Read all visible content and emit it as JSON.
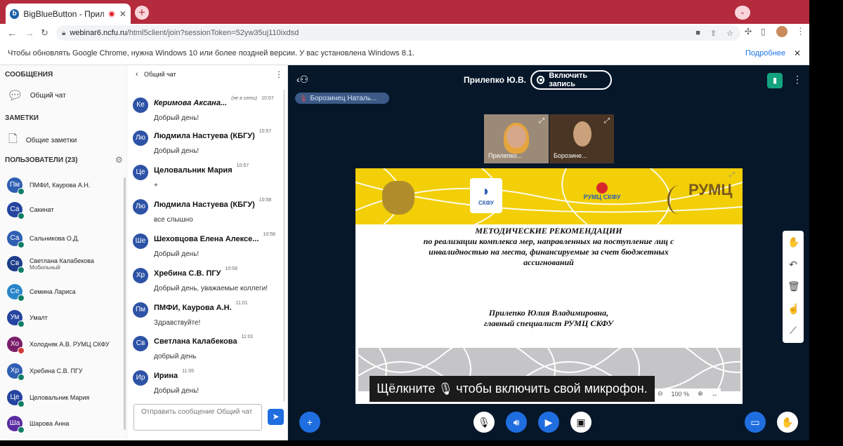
{
  "browser": {
    "tab_title": "BigBlueButton - Прилепко Н",
    "url_host": "webinar6.ncfu.ru",
    "url_path": "/html5client/join?sessionToken=52yw35uj110ixdsd",
    "info_text": "Чтобы обновлять Google Chrome, нужна Windows 10 или более поздней версии. У вас установлена Windows 8.1.",
    "info_link": "Подробнее"
  },
  "sidebar": {
    "messages_header": "СООБЩЕНИЯ",
    "public_chat": "Общий чат",
    "notes_header": "ЗАМЕТКИ",
    "shared_notes": "Общие заметки",
    "users_header": "ПОЛЬЗОВАТЕЛИ (23)",
    "users": [
      {
        "initials": "Пм",
        "name": "ПМФИ, Каурова А.Н.",
        "color": "#2f5fb3"
      },
      {
        "initials": "Са",
        "name": "Сакинат",
        "color": "#2544a0"
      },
      {
        "initials": "Са",
        "name": "Сальникова О.Д.",
        "color": "#2f5fb3"
      },
      {
        "initials": "Св",
        "name": "Светлана Калабекова",
        "sub": "Мобильный",
        "color": "#1d3d8a"
      },
      {
        "initials": "Се",
        "name": "Семина Лариса",
        "color": "#2986c9"
      },
      {
        "initials": "Ум",
        "name": "Умалт",
        "color": "#2544a0"
      },
      {
        "initials": "Хо",
        "name": "Холодняк А.В. РУМЦ СКФУ",
        "color": "#7b1e6a"
      },
      {
        "initials": "Хр",
        "name": "Хребина С.В. ПГУ",
        "color": "#2f5fb3"
      },
      {
        "initials": "Це",
        "name": "Целовальник Мария",
        "color": "#2544a0"
      },
      {
        "initials": "Ша",
        "name": "Шарова Анна",
        "color": "#5a2aa0"
      }
    ]
  },
  "chat": {
    "title": "Общий чат",
    "messages": [
      {
        "initials": "Ке",
        "name": "Керимова Аксана...",
        "status": "(не в сети)",
        "time": "10:57",
        "text": "Добрый день!"
      },
      {
        "initials": "Лю",
        "name": "Людмила Настуева (КБГУ)",
        "time": "10:57",
        "text": "Добрый день!"
      },
      {
        "initials": "Це",
        "name": "Целовальник Мария",
        "time": "10:57",
        "text": "+"
      },
      {
        "initials": "Лю",
        "name": "Людмила Настуева (КБГУ)",
        "time": "10:58",
        "text": "все слышно"
      },
      {
        "initials": "Ше",
        "name": "Шеховцова Елена Алексе...",
        "time": "10:58",
        "text": "Добрый день!"
      },
      {
        "initials": "Хр",
        "name": "Хребина С.В. ПГУ",
        "time": "10:58",
        "text": "Добрый день, уважаемые коллеги!"
      },
      {
        "initials": "Пм",
        "name": "ПМФИ, Каурова А.Н.",
        "time": "11:01",
        "text": "Здравствуйте!"
      },
      {
        "initials": "Св",
        "name": "Светлана Калабекова",
        "time": "11:01",
        "text": "добрый день"
      },
      {
        "initials": "Ир",
        "name": "Ирина",
        "time": "11:05",
        "text": "Добрый день!"
      }
    ],
    "input_placeholder": "Отправить сообщение Общий чат"
  },
  "main": {
    "presenter": "Прилепко Ю.В.",
    "record_label": "Включить запись",
    "talking": "Борозинец Наталь...",
    "video1": "Прилепко...",
    "video2": "Борозине...",
    "slide_logo_ncfu": "СКФУ",
    "slide_logo_rumc_ncfu": "РУМЦ СКФУ",
    "slide_logo_rumc": "РУМЦ",
    "slide_title": "МЕТОДИЧЕСКИЕ РЕКОМЕНДАЦИИ",
    "slide_l1": "по реализации комплекса мер, направленных на поступление лиц с",
    "slide_l2": "инвалидностью на места, финансируемые за счет бюджетных",
    "slide_l3": "ассигнований",
    "slide_author": "Прилепко Юлия Владимировна,",
    "slide_role": "главный специалист РУМЦ СКФУ",
    "zoom": "100 %",
    "mic_caption_a": "Щёлкните",
    "mic_caption_b": "чтобы включить свой микрофон."
  }
}
